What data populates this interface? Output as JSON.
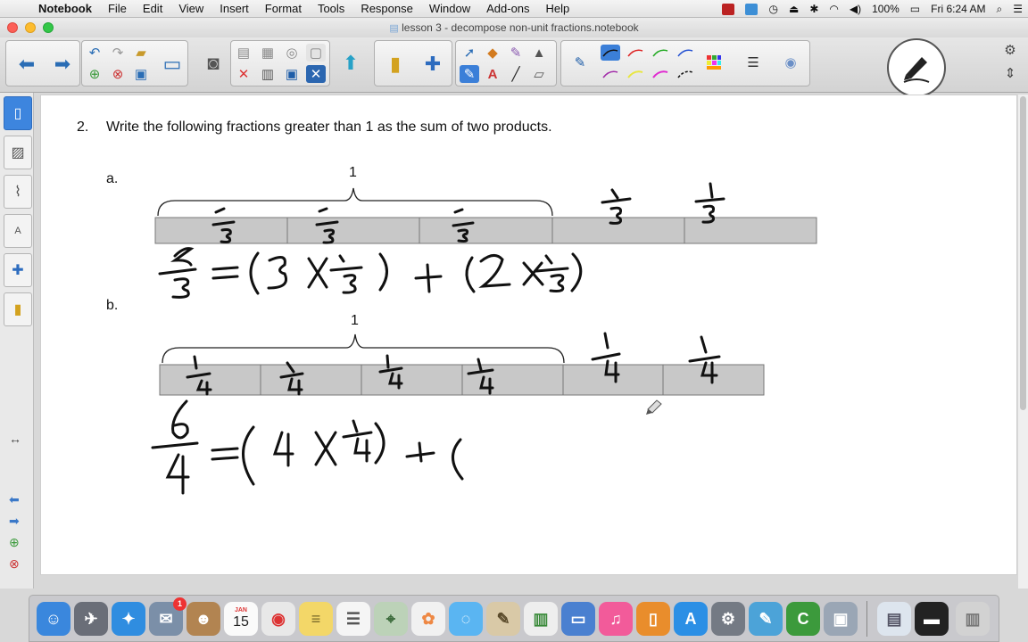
{
  "menubar": {
    "items": [
      "Notebook",
      "File",
      "Edit",
      "View",
      "Insert",
      "Format",
      "Tools",
      "Response",
      "Window",
      "Add-ons",
      "Help"
    ],
    "battery": "100%",
    "clock": "Fri 6:24 AM"
  },
  "window": {
    "title": "lesson 3 - decompose non-unit fractions.notebook"
  },
  "question": {
    "number": "2.",
    "text": "Write the following fractions greater than 1 as the sum of two products.",
    "part_a_label": "a.",
    "part_b_label": "b.",
    "brace_a_label": "1",
    "brace_b_label": "1"
  },
  "handwriting": {
    "a_equation": "5/3 = (3 x 1/3) + (2 x 1/3)",
    "b_equation": "6/4 = (4 x 1/4) + ("
  },
  "dock": {
    "calendar_month": "JAN",
    "calendar_day": "15",
    "badge": "1"
  },
  "colors": {
    "accent": "#3b7fd8",
    "bar_fill": "#c8c8c8",
    "bar_border": "#777777"
  }
}
